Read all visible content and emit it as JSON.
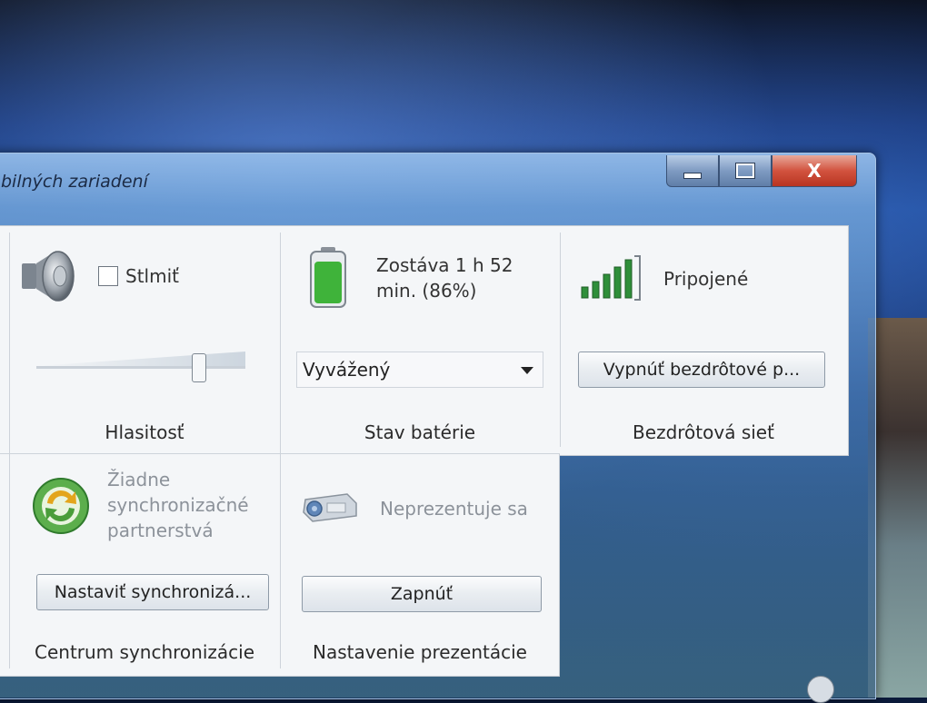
{
  "window": {
    "title": "bilných zariadení",
    "close_glyph": "X"
  },
  "volume": {
    "mute_label": "Stlmiť",
    "muted": false,
    "level": 0.8,
    "caption": "Hlasitosť"
  },
  "battery": {
    "status": "Zostáva 1 h 52 min. (86%)",
    "plan_selected": "Vyvážený",
    "caption": "Stav batérie",
    "charge_fraction": 0.86
  },
  "wireless": {
    "status": "Pripojené",
    "button_label": "Vypnúť bezdrôtové p...",
    "caption": "Bezdrôtová sieť",
    "signal_bars": 5
  },
  "sync": {
    "status": "Žiadne synchronizačné partnerstvá",
    "button_label": "Nastaviť synchronizá...",
    "caption": "Centrum synchronizácie"
  },
  "presentation": {
    "status": "Neprezentuje sa",
    "button_label": "Zapnúť",
    "caption": "Nastavenie prezentácie"
  },
  "colors": {
    "battery_green": "#3fb33a",
    "signal_green": "#2f8f3a",
    "close_red": "#c8402d"
  }
}
